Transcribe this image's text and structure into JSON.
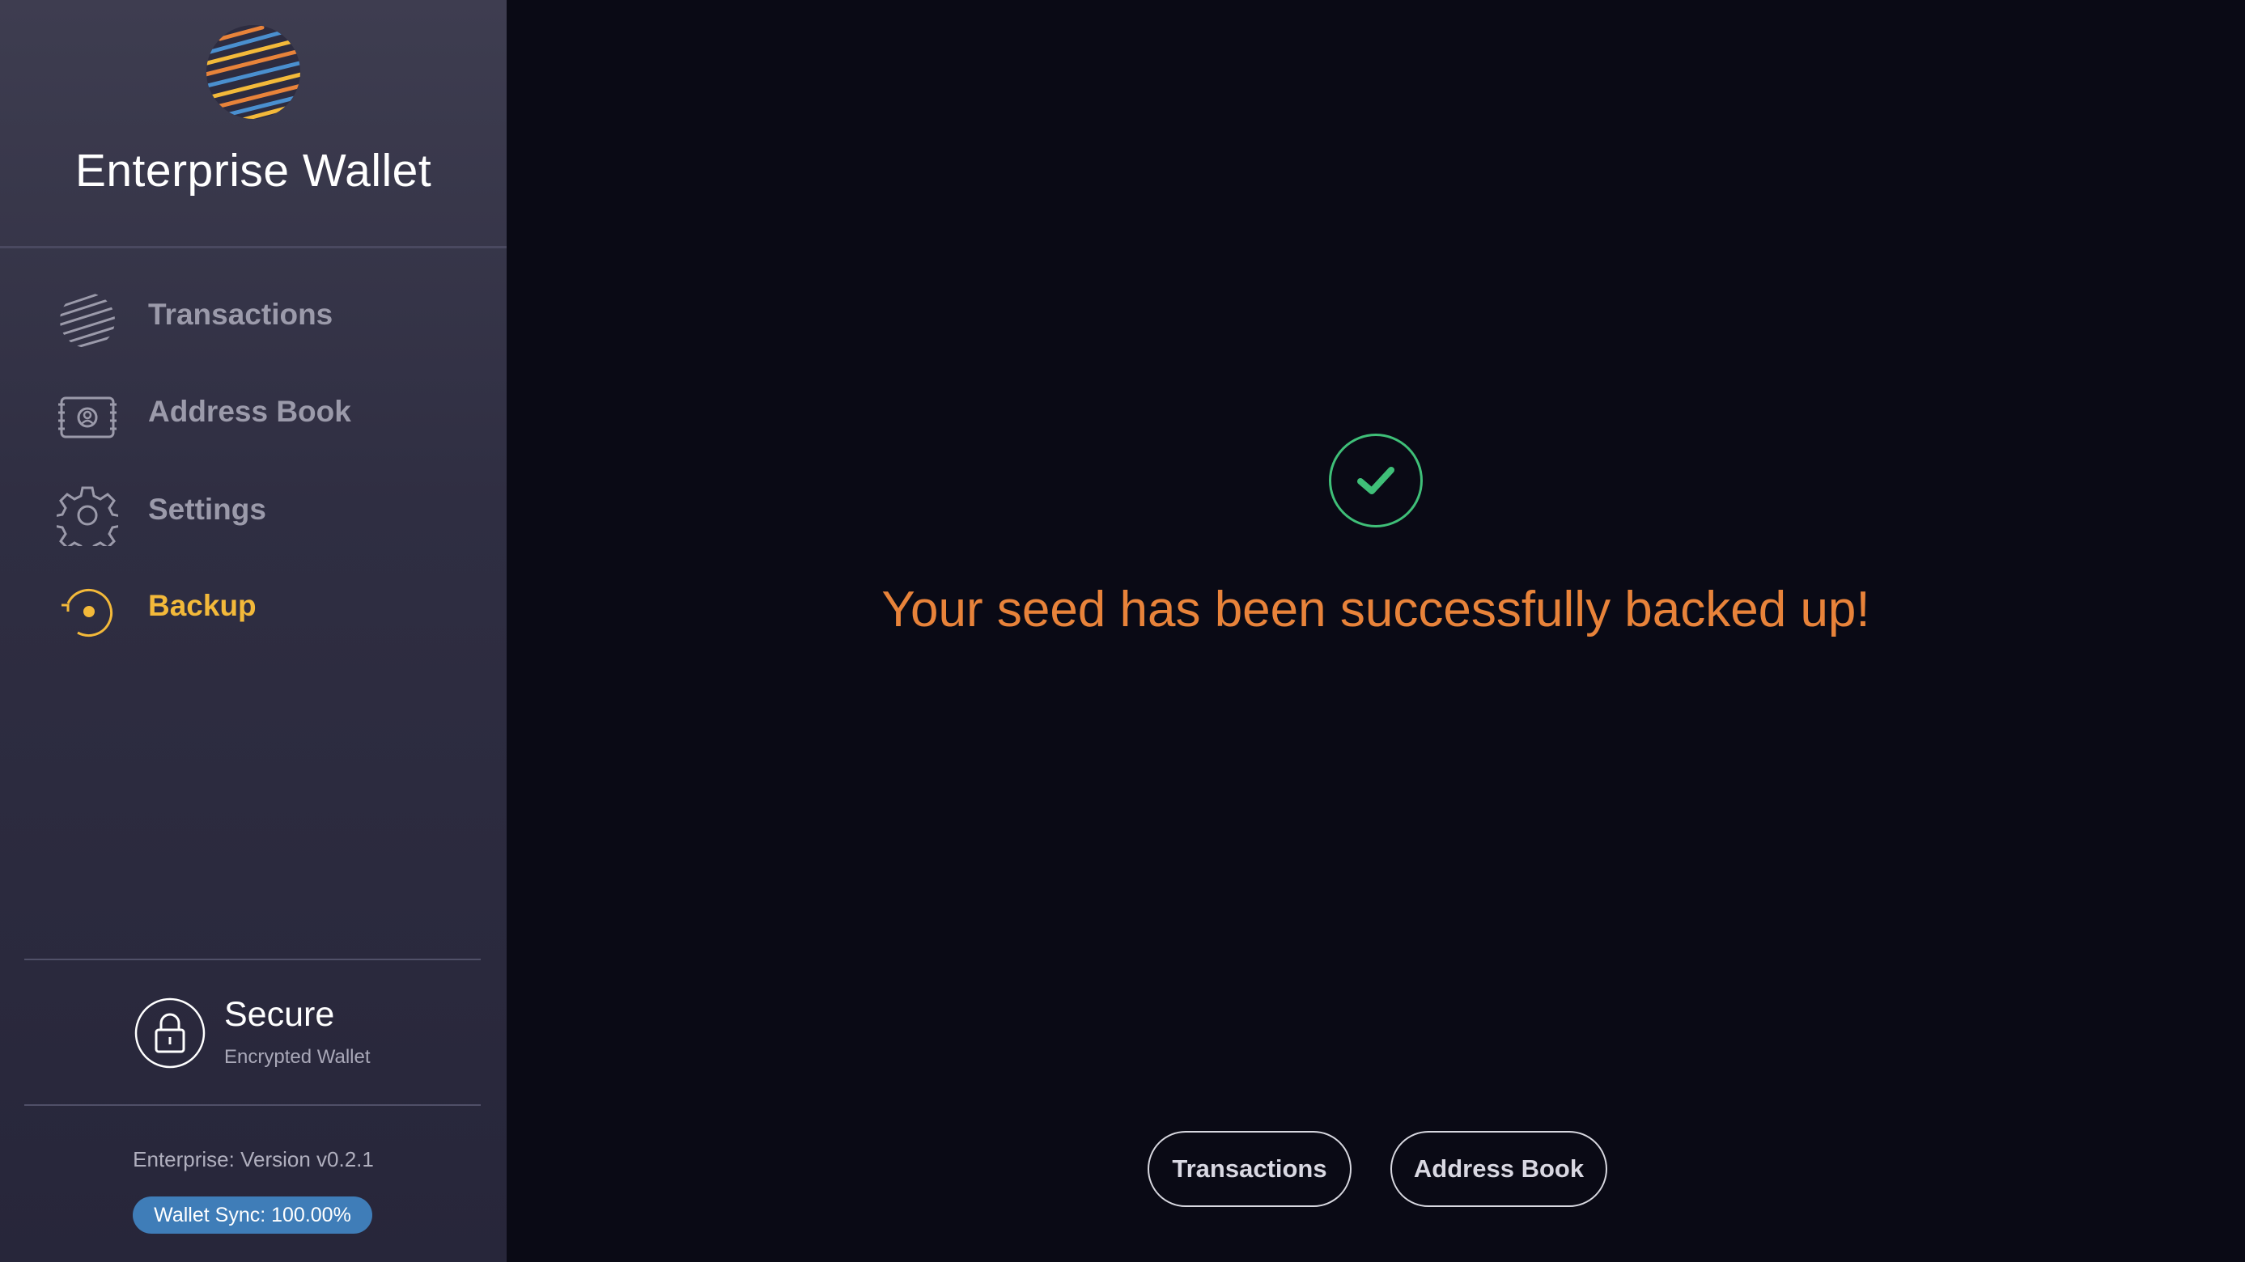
{
  "app": {
    "title": "Enterprise Wallet"
  },
  "sidebar": {
    "items": [
      {
        "label": "Transactions",
        "icon": "globe-icon",
        "active": false
      },
      {
        "label": "Address Book",
        "icon": "address-book-icon",
        "active": false
      },
      {
        "label": "Settings",
        "icon": "gear-icon",
        "active": false
      },
      {
        "label": "Backup",
        "icon": "backup-icon",
        "active": true
      }
    ],
    "security": {
      "title": "Secure",
      "subtitle": "Encrypted Wallet",
      "icon": "lock-icon"
    },
    "version": "Enterprise: Version v0.2.1",
    "sync": "Wallet Sync: 100.00%"
  },
  "main": {
    "status_icon": "check-icon",
    "message": "Your seed has been successfully backed up!",
    "buttons": {
      "transactions": "Transactions",
      "address_book": "Address Book"
    }
  },
  "colors": {
    "accent": "#f3b93a",
    "success": "#3fbf78",
    "message": "#e8833a",
    "sync_badge": "#3f7db8",
    "background": "#0a0a15"
  }
}
